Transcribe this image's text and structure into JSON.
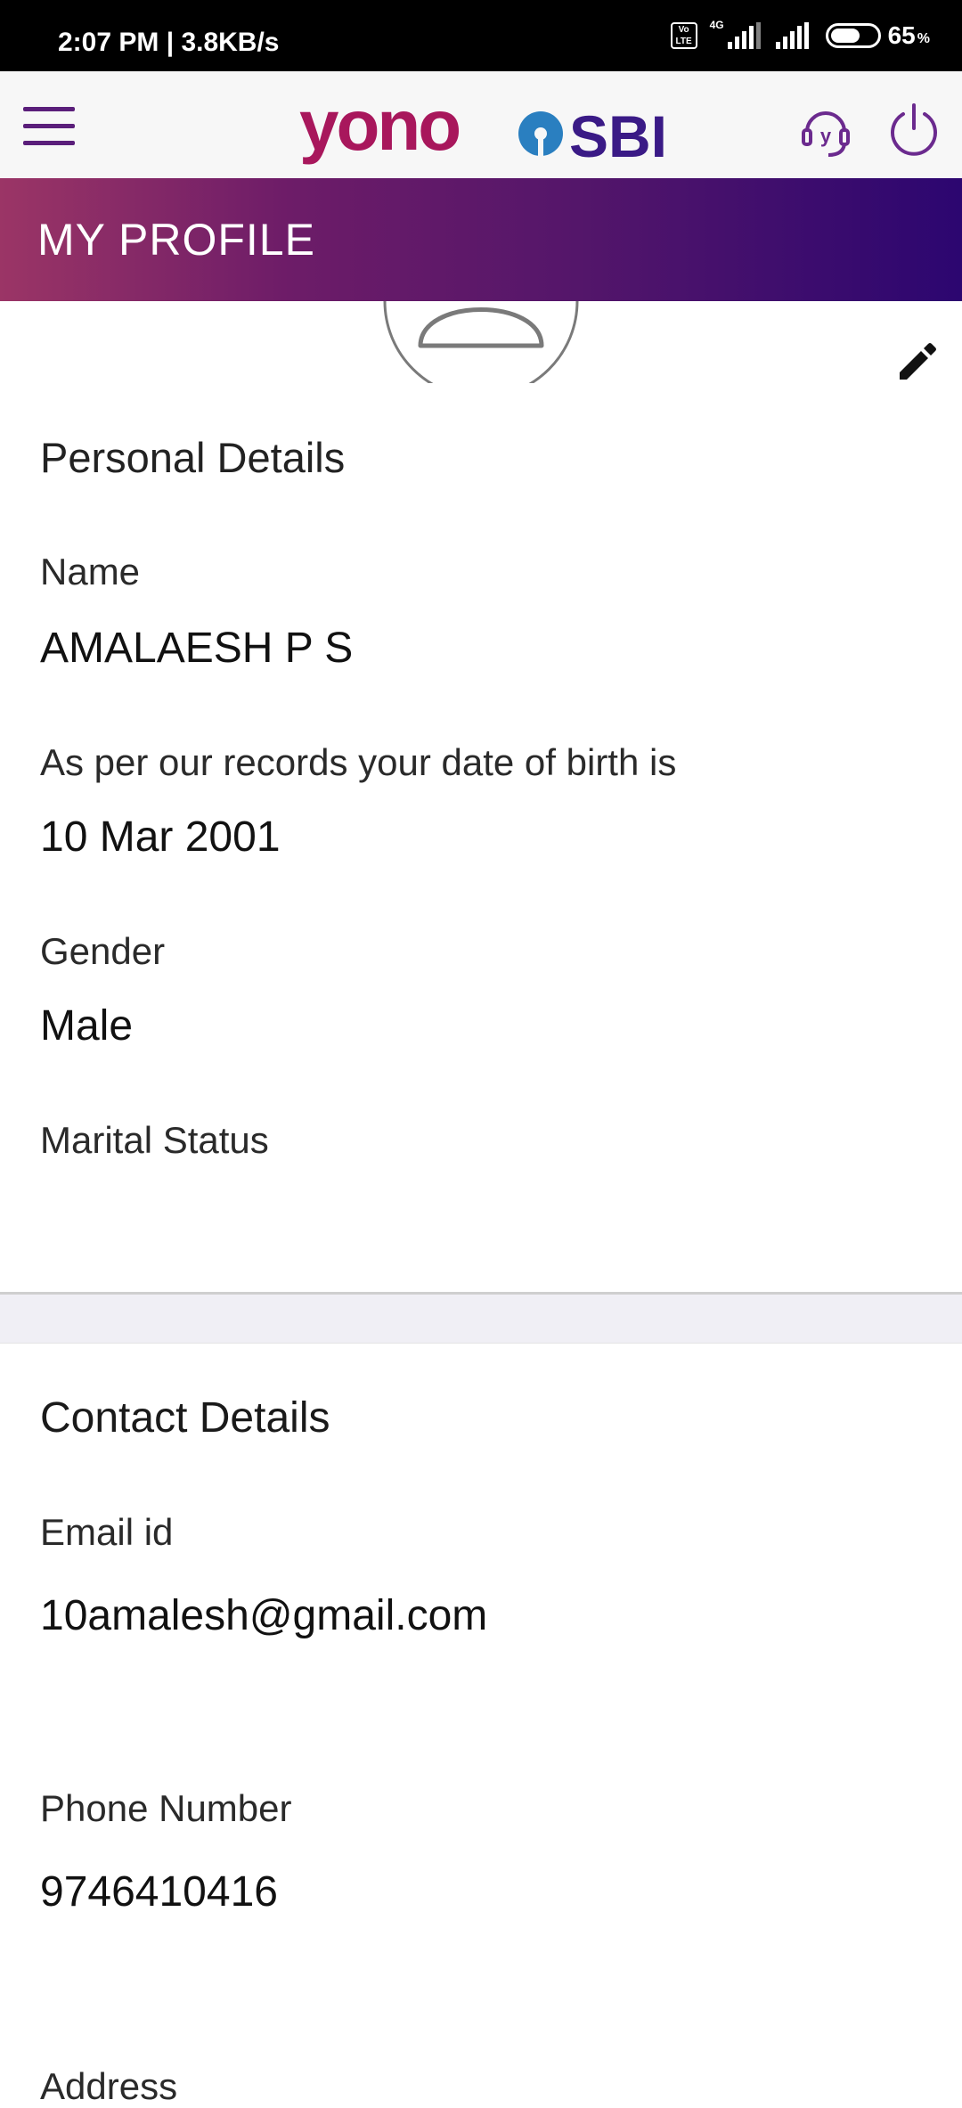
{
  "status_bar": {
    "time_speed": "2:07 PM | 3.8KB/s",
    "volte": "Vo LTE",
    "network": "4G",
    "battery_percent": "65",
    "battery_sign": "%",
    "battery_level": 0.65
  },
  "header": {
    "logo_yono": "yono",
    "logo_sbi": "SBI",
    "menu_icon": "hamburger-menu-icon",
    "help_icon": "customer-support-icon",
    "power_icon": "power-logout-icon"
  },
  "banner": {
    "title": "MY PROFILE"
  },
  "personal": {
    "title": "Personal Details",
    "name_label": "Name",
    "name_value": "AMALAESH P S",
    "dob_label": "As per our records your date of birth is",
    "dob_value": "10 Mar 2001",
    "gender_label": "Gender",
    "gender_value": "Male",
    "marital_label": "Marital Status"
  },
  "contact": {
    "title": "Contact Details",
    "email_label": "Email id",
    "email_value": "10amalesh@gmail.com",
    "phone_label": "Phone Number",
    "phone_value": "9746410416",
    "address_label": "Address"
  },
  "colors": {
    "banner_start": "#9b3566",
    "banner_end": "#2c0670",
    "brand_purple": "#5a1e7a",
    "yono_magenta": "#a8175c",
    "sbi_blue": "#2a7fc0",
    "sbi_purple": "#3a1a86"
  }
}
